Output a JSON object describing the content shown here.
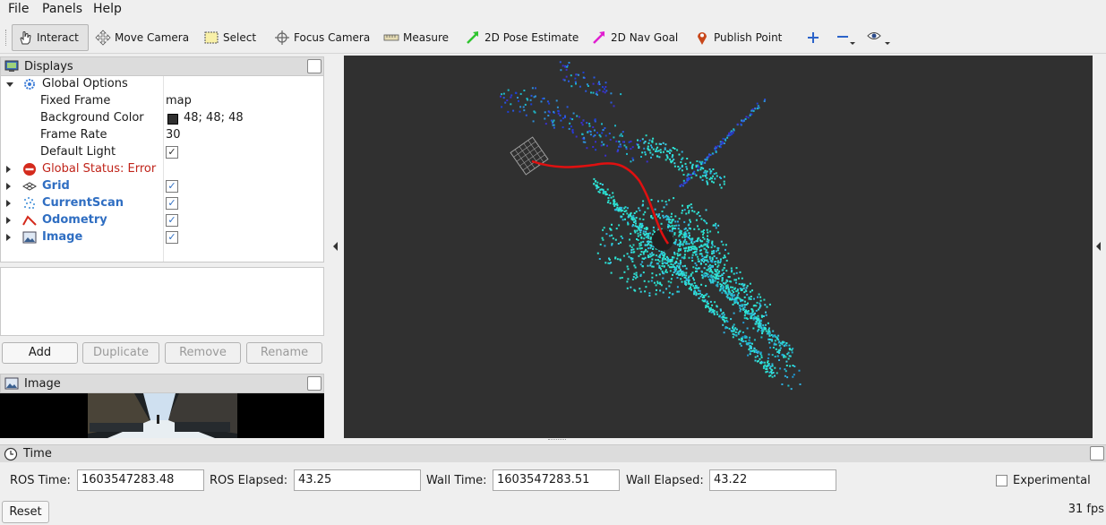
{
  "menu": {
    "file": "File",
    "panels": "Panels",
    "help": "Help"
  },
  "toolbar": {
    "interact": "Interact",
    "move_camera": "Move Camera",
    "select": "Select",
    "focus_camera": "Focus Camera",
    "measure": "Measure",
    "pose_estimate": "2D Pose Estimate",
    "nav_goal": "2D Nav Goal",
    "publish_point": "Publish Point"
  },
  "displays_panel": {
    "title": "Displays",
    "global_options": "Global Options",
    "props": [
      {
        "label": "Fixed Frame",
        "value": "map"
      },
      {
        "label": "Background Color",
        "value": "48; 48; 48"
      },
      {
        "label": "Frame Rate",
        "value": "30"
      },
      {
        "label": "Default Light",
        "value": "✓"
      }
    ],
    "global_status": "Global Status: Error",
    "displays": [
      {
        "label": "Grid",
        "check": "✓"
      },
      {
        "label": "CurrentScan",
        "check": "✓"
      },
      {
        "label": "Odometry",
        "check": "✓"
      },
      {
        "label": "Image",
        "check": "✓"
      }
    ],
    "buttons": {
      "add": "Add",
      "duplicate": "Duplicate",
      "remove": "Remove",
      "rename": "Rename"
    }
  },
  "image_panel": {
    "title": "Image"
  },
  "time_panel": {
    "title": "Time",
    "ros_time_label": "ROS Time:",
    "ros_time": "1603547283.48",
    "ros_elapsed_label": "ROS Elapsed:",
    "ros_elapsed": "43.25",
    "wall_time_label": "Wall Time:",
    "wall_time": "1603547283.51",
    "wall_elapsed_label": "Wall Elapsed:",
    "wall_elapsed": "43.22",
    "experimental": "Experimental",
    "reset": "Reset",
    "fps": "31 fps"
  },
  "colors": {
    "background": "#303030",
    "scan_primary": "#2ee6d6",
    "scan_far": "#1f3fd6",
    "trajectory": "#e01010",
    "error": "#c0241a",
    "link_blue": "#2f6ec2"
  }
}
